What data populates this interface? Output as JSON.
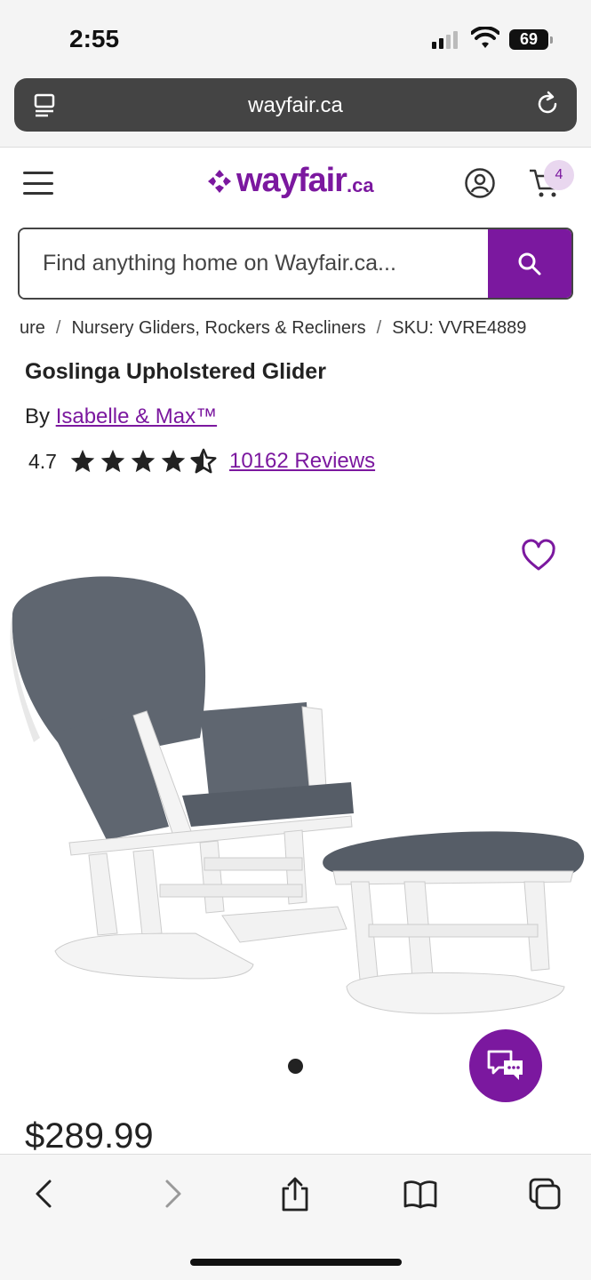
{
  "status": {
    "time": "2:55",
    "battery": "69"
  },
  "browser": {
    "url": "wayfair.ca"
  },
  "header": {
    "brand": "wayfair",
    "tld": ".ca",
    "cart_count": "4"
  },
  "search": {
    "placeholder": "Find anything home on Wayfair.ca..."
  },
  "breadcrumb": {
    "items": [
      "ure",
      "Nursery Gliders, Rockers & Recliners",
      "SKU: VVRE4889"
    ]
  },
  "product": {
    "title": "Goslinga Upholstered Glider",
    "by_label": "By",
    "brand": "Isabelle & Max™",
    "rating": "4.7",
    "rating_value": 4.7,
    "reviews": "10162 Reviews",
    "price": "$289.99"
  },
  "colors": {
    "accent": "#7b189f",
    "cushion": "#5f6670",
    "frame": "#f2f2f2"
  },
  "icons": {
    "tabs": "tabs-icon",
    "reload": "reload-icon",
    "share": "share-icon",
    "bookmarks": "book-icon"
  }
}
